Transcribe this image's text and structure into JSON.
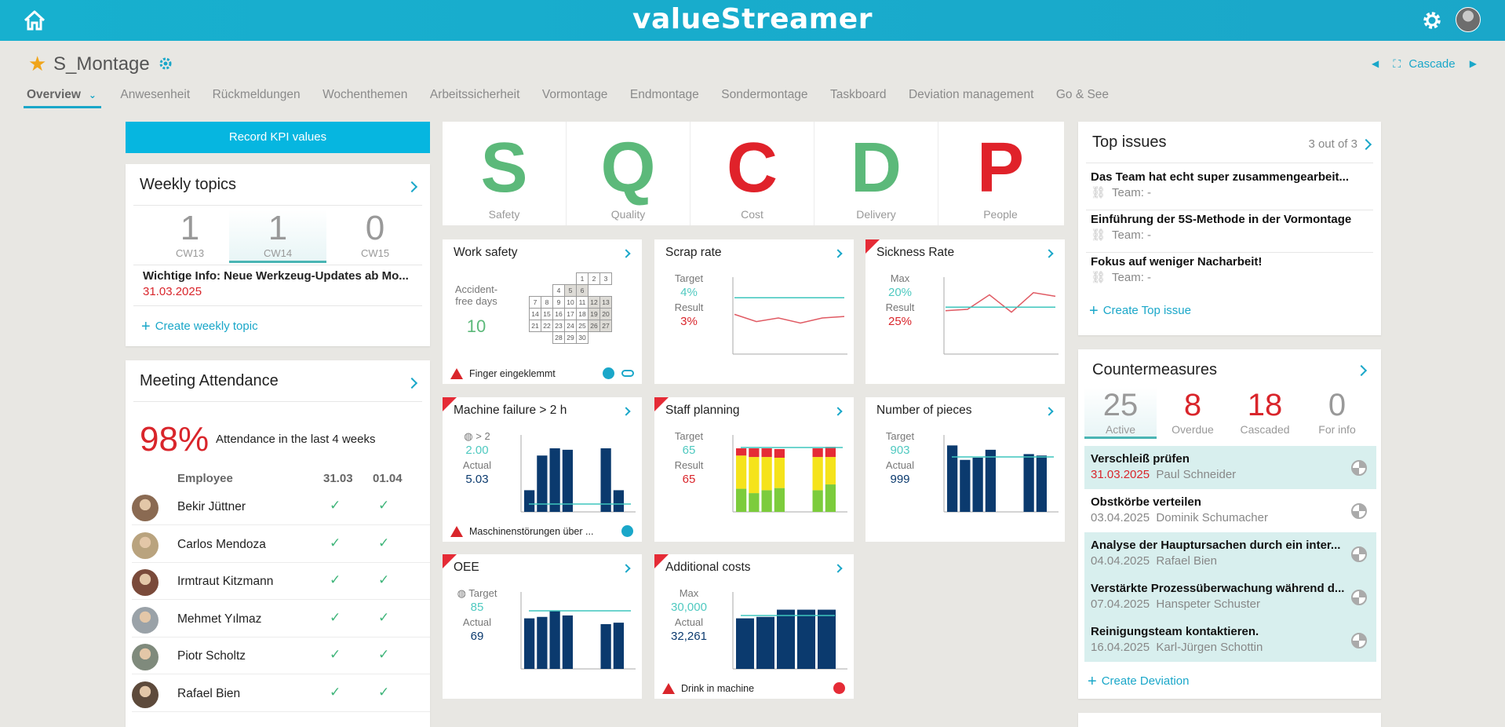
{
  "header": {
    "logo": "valueStreamer"
  },
  "page": {
    "title": "S_Montage",
    "cascade_label": "Cascade"
  },
  "tabs": [
    "Overview",
    "Anwesenheit",
    "Rückmeldungen",
    "Wochenthemen",
    "Arbeitssicherheit",
    "Vormontage",
    "Endmontage",
    "Sondermontage",
    "Taskboard",
    "Deviation management",
    "Go & See"
  ],
  "record_kpi_label": "Record KPI values",
  "weekly_topics": {
    "title": "Weekly topics",
    "weeks": [
      {
        "num": "1",
        "label": "CW13"
      },
      {
        "num": "1",
        "label": "CW14"
      },
      {
        "num": "0",
        "label": "CW15"
      }
    ],
    "topic": "Wichtige Info: Neue Werkzeug-Updates ab Mo...",
    "topic_date": "31.03.2025",
    "create_label": "Create weekly topic"
  },
  "attendance": {
    "title": "Meeting Attendance",
    "percent": "98%",
    "description": "Attendance in the last 4 weeks",
    "col_employee": "Employee",
    "col_d1": "31.03",
    "col_d2": "01.04",
    "employees": [
      "Bekir Jüttner",
      "Carlos Mendoza",
      "Irmtraut Kitzmann",
      "Mehmet Yılmaz",
      "Piotr Scholtz",
      "Rafael Bien"
    ],
    "check": "✓"
  },
  "sqcdp": [
    {
      "letter": "S",
      "name": "Safety",
      "color": "#5cb97a"
    },
    {
      "letter": "Q",
      "name": "Quality",
      "color": "#5cb97a"
    },
    {
      "letter": "C",
      "name": "Cost",
      "color": "#e0222a"
    },
    {
      "letter": "D",
      "name": "Delivery",
      "color": "#5cb97a"
    },
    {
      "letter": "P",
      "name": "People",
      "color": "#e0222a"
    }
  ],
  "kpis": {
    "work_safety": {
      "title": "Work safety",
      "label": "Accident-\nfree days",
      "value": "10",
      "footer": "Finger eingeklemmt",
      "calendar": [
        [
          "",
          "",
          "1",
          "2",
          "3"
        ],
        [
          "",
          "4",
          "5",
          "6",
          ""
        ],
        [
          "7",
          "8",
          "9",
          "10",
          "11",
          "12",
          "13"
        ],
        [
          "14",
          "15",
          "16",
          "17",
          "18",
          "19",
          "20"
        ],
        [
          "21",
          "22",
          "23",
          "24",
          "25",
          "26",
          "27"
        ],
        [
          "",
          "",
          "28",
          "29",
          "30",
          "",
          ""
        ]
      ]
    },
    "scrap_rate": {
      "title": "Scrap rate",
      "target_label": "Target",
      "target": "4%",
      "result_label": "Result",
      "result": "3%"
    },
    "sickness": {
      "title": "Sickness Rate",
      "max_label": "Max",
      "max": "20%",
      "result_label": "Result",
      "result": "25%"
    },
    "machine_failure": {
      "title": "Machine failure > 2 h",
      "target": "> 2",
      "target2": "2.00",
      "actual_label": "Actual",
      "actual": "5.03",
      "footer": "Maschinenstörungen über ..."
    },
    "staff_planning": {
      "title": "Staff planning",
      "target_label": "Target",
      "target": "65",
      "result_label": "Result",
      "result": "65"
    },
    "pieces": {
      "title": "Number of pieces",
      "target_label": "Target",
      "target": "903",
      "actual_label": "Actual",
      "actual": "999"
    },
    "oee": {
      "title": "OEE",
      "target_label": "Target",
      "target": "85",
      "actual_label": "Actual",
      "actual": "69"
    },
    "additional_costs": {
      "title": "Additional costs",
      "max_label": "Max",
      "max": "30,000",
      "actual_label": "Actual",
      "actual": "32,261",
      "footer": "Drink in machine"
    }
  },
  "top_issues": {
    "title": "Top issues",
    "count": "3 out of 3",
    "issues": [
      {
        "title": "Das Team hat echt super zusammengearbeit...",
        "team": "Team: -"
      },
      {
        "title": "Einführung der 5S-Methode in der Vormontage",
        "team": "Team: -"
      },
      {
        "title": "Fokus auf weniger Nacharbeit!",
        "team": "Team: -"
      }
    ],
    "create_label": "Create Top issue"
  },
  "countermeasures": {
    "title": "Countermeasures",
    "stats": [
      {
        "num": "25",
        "label": "Active",
        "color": "#999"
      },
      {
        "num": "8",
        "label": "Overdue",
        "color": "#d9252b"
      },
      {
        "num": "18",
        "label": "Cascaded",
        "color": "#d9252b"
      },
      {
        "num": "0",
        "label": "For info",
        "color": "#999"
      }
    ],
    "items": [
      {
        "title": "Verschleiß prüfen",
        "date": "31.03.2025",
        "person": "Paul Schneider",
        "overdue": true
      },
      {
        "title": "Obstkörbe verteilen",
        "date": "03.04.2025",
        "person": "Dominik Schumacher",
        "overdue": false
      },
      {
        "title": "Analyse der Hauptursachen durch ein inter...",
        "date": "04.04.2025",
        "person": "Rafael Bien",
        "overdue": false
      },
      {
        "title": "Verstärkte Prozessüberwachung während d...",
        "date": "07.04.2025",
        "person": "Hanspeter Schuster",
        "overdue": false
      },
      {
        "title": "Reinigungsteam kontaktieren.",
        "date": "16.04.2025",
        "person": "Karl-Jürgen Schottin",
        "overdue": false
      }
    ],
    "create_label": "Create Deviation"
  }
}
